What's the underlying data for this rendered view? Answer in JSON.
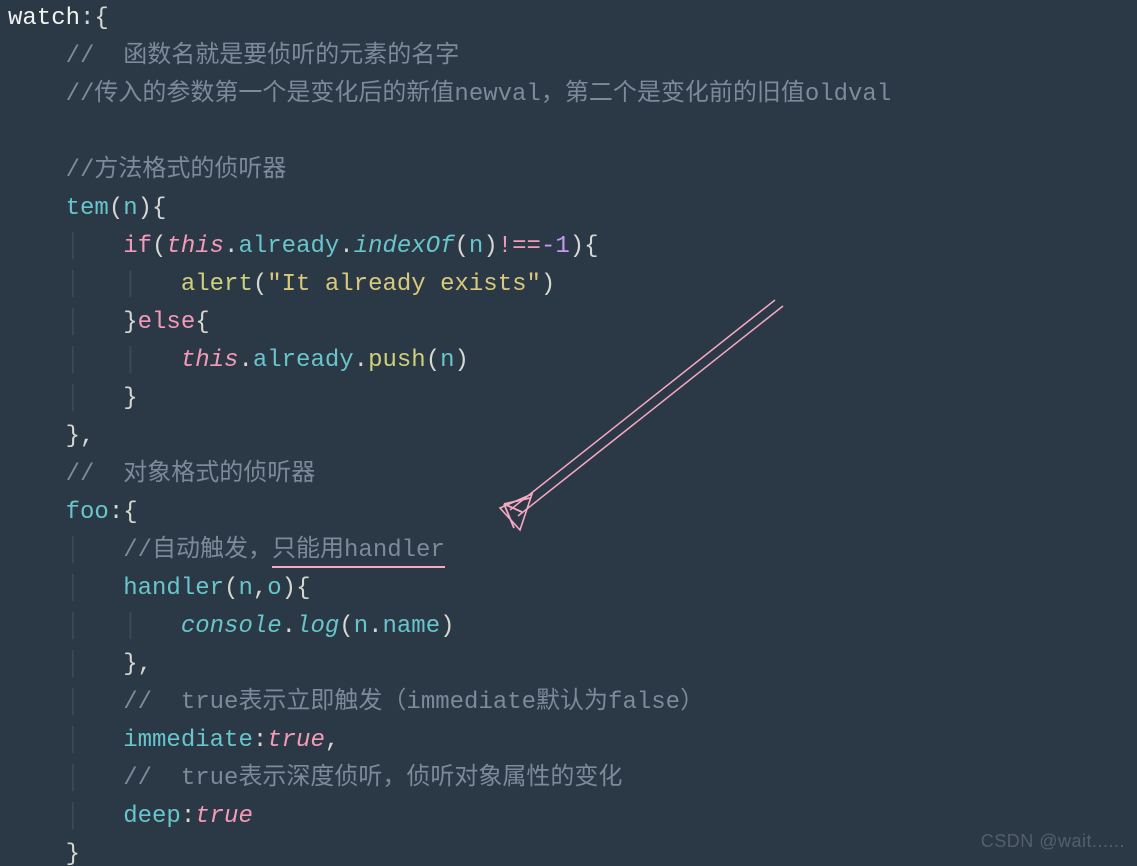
{
  "code": {
    "l1_watch": "watch",
    "l2_comment": "//  函数名就是要侦听的元素的名字",
    "l3_comment": "//传入的参数第一个是变化后的新值newval，第二个是变化前的旧值oldval",
    "l5_comment": "//方法格式的侦听器",
    "l6_tem": "tem",
    "l6_param_n": "n",
    "l7_if": "if",
    "l7_this": "this",
    "l7_already": "already",
    "l7_indexOf": "indexOf",
    "l7_n": "n",
    "l7_op_neq": "!==",
    "l7_neg1": "-1",
    "l8_alert": "alert",
    "l8_str": "\"It already exists\"",
    "l9_else": "else",
    "l10_this": "this",
    "l10_already": "already",
    "l10_push": "push",
    "l10_n": "n",
    "l13_comment": "//  对象格式的侦听器",
    "l14_foo": "foo",
    "l15_comment_a": "//自动触发，",
    "l15_comment_b": "只能用handler",
    "l16_handler": "handler",
    "l16_n": "n",
    "l16_o": "o",
    "l17_console": "console",
    "l17_log": "log",
    "l17_n": "n",
    "l17_name": "name",
    "l19_comment": "//  true表示立即触发（immediate默认为false）",
    "l20_immediate": "immediate",
    "l20_true": "true",
    "l21_comment": "//  true表示深度侦听，侦听对象属性的变化",
    "l22_deep": "deep",
    "l22_true": "true"
  },
  "watermark": "CSDN @wait......"
}
